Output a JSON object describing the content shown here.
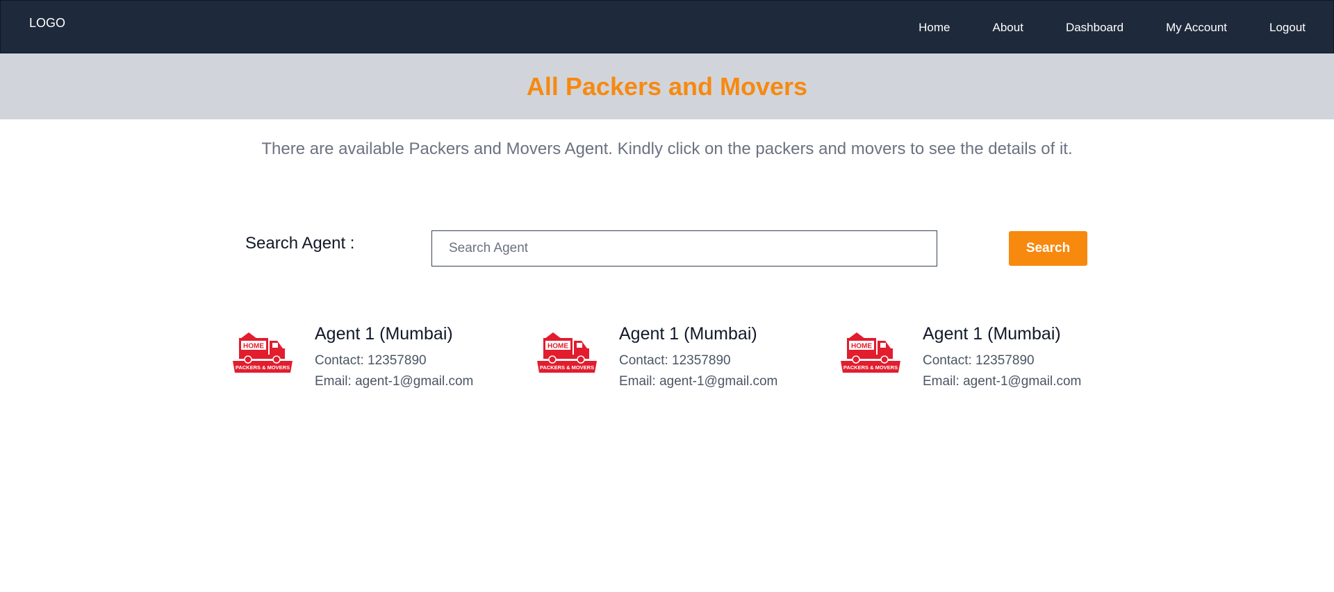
{
  "header": {
    "logo": "LOGO",
    "nav": [
      "Home",
      "About",
      "Dashboard",
      "My Account",
      "Logout"
    ]
  },
  "banner": {
    "title": "All Packers and Movers"
  },
  "intro": "There are available Packers and Movers Agent. Kindly click on the packers and movers to see the details of it.",
  "search": {
    "label": "Search Agent :",
    "placeholder": "Search Agent",
    "value": "",
    "button": "Search"
  },
  "agents": [
    {
      "name": "Agent 1 (Mumbai)",
      "contact": "Contact: 12357890",
      "email": "Email: agent-1@gmail.com",
      "logo_text_top": "HOME",
      "logo_text_bottom": "PACKERS & MOVERS"
    },
    {
      "name": "Agent 1 (Mumbai)",
      "contact": "Contact: 12357890",
      "email": "Email: agent-1@gmail.com",
      "logo_text_top": "HOME",
      "logo_text_bottom": "PACKERS & MOVERS"
    },
    {
      "name": "Agent 1 (Mumbai)",
      "contact": "Contact: 12357890",
      "email": "Email: agent-1@gmail.com",
      "logo_text_top": "HOME",
      "logo_text_bottom": "PACKERS & MOVERS"
    }
  ],
  "colors": {
    "navbar": "#1e293b",
    "banner": "#d1d5db",
    "accent": "#f7890f",
    "logo_red": "#e11d2e"
  }
}
